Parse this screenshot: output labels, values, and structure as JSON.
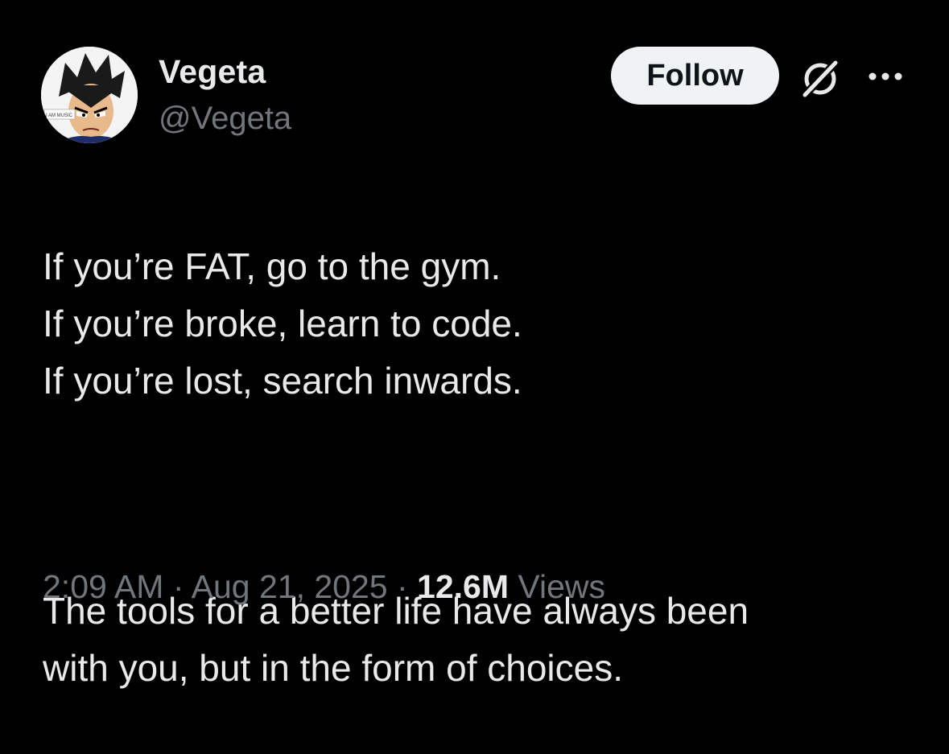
{
  "author": {
    "name": "Vegeta",
    "handle": "@Vegeta",
    "avatar_badge": "I AM MUSIC"
  },
  "actions": {
    "follow_label": "Follow",
    "grok_icon": "grok-icon",
    "more_icon": "more-horizontal-icon"
  },
  "tweet": {
    "paragraph1": "If you’re FAT, go to the gym.\nIf you’re broke, learn to code.\nIf you’re lost, search inwards.",
    "paragraph2": "The tools for a better life have always been\nwith you, but in the form of choices."
  },
  "meta": {
    "time": "2:09 AM",
    "separator": "·",
    "date": "Aug 21, 2025",
    "views_count": "12.6M",
    "views_label": "Views"
  },
  "colors": {
    "background": "#000000",
    "primary_text": "#e7e9ea",
    "secondary_text": "#71767b",
    "follow_bg": "#eff3f4",
    "follow_text": "#0f1419"
  }
}
